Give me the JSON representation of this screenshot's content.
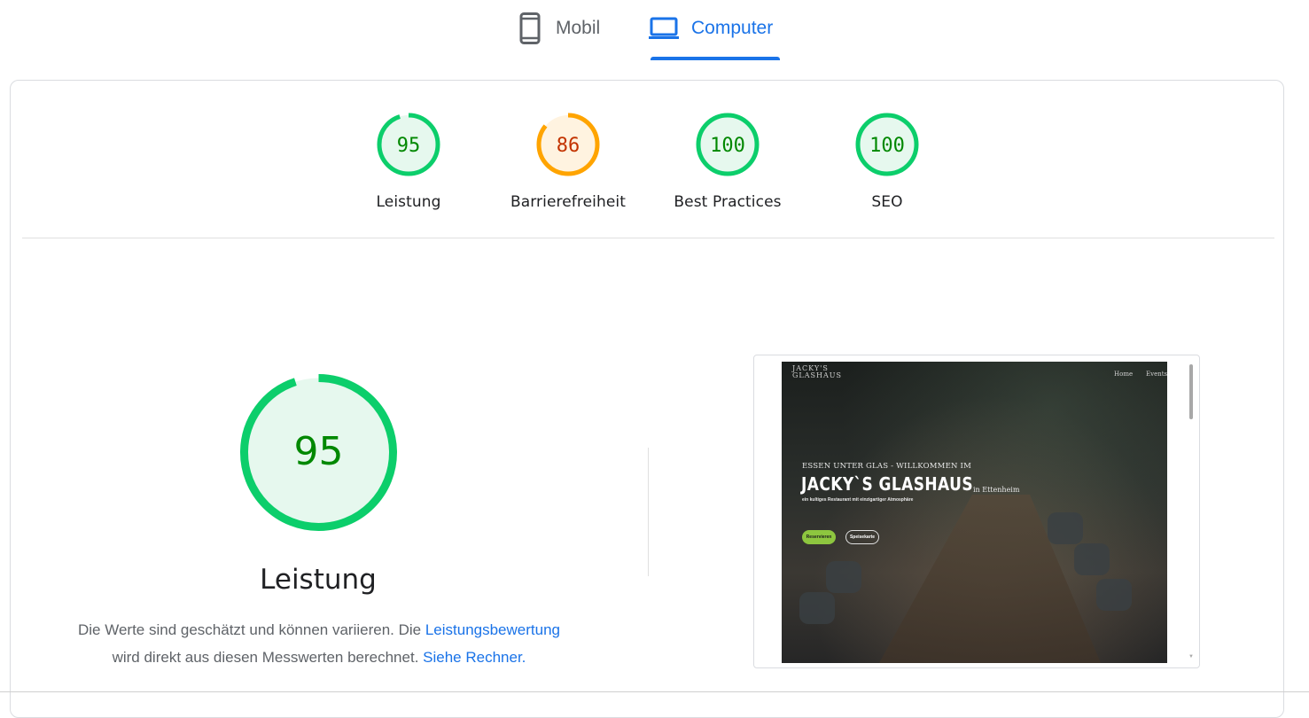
{
  "tabs": [
    {
      "label": "Mobil",
      "icon": "smartphone-icon",
      "active": false
    },
    {
      "label": "Computer",
      "icon": "laptop-icon",
      "active": true
    }
  ],
  "colors": {
    "pass": "#0cce6b",
    "pass_text": "#008800",
    "average": "#ffa400",
    "average_text": "#c33300",
    "accent": "#1a73e8"
  },
  "scores": [
    {
      "label": "Leistung",
      "value": "95",
      "status": "pass"
    },
    {
      "label": "Barrierefreiheit",
      "value": "86",
      "status": "average"
    },
    {
      "label": "Best Practices",
      "value": "100",
      "status": "pass"
    },
    {
      "label": "SEO",
      "value": "100",
      "status": "pass"
    }
  ],
  "main": {
    "score": "95",
    "title": "Leistung",
    "desc_part1": "Die Werte sind geschätzt und können variieren. Die ",
    "desc_link1": "Leistungsbewertung",
    "desc_part2": " wird direkt aus diesen Messwerten berechnet.",
    "desc_link2": "Siehe Rechner."
  },
  "screenshot": {
    "logo_line1": "JACKY'S",
    "logo_line2": "GLASHAUS",
    "nav": [
      "Home",
      "Events"
    ],
    "eyebrow": "ESSEN UNTER GLAS - WILLKOMMEN IM",
    "hero": "JACKY`S GLASHAUS",
    "hero_sub": "in Ettenheim",
    "tagline": "ein kultiges Restaurant mit einzigartiger Atmosphäre",
    "button_primary": "Reservieren",
    "button_secondary": "Speisekarte"
  }
}
